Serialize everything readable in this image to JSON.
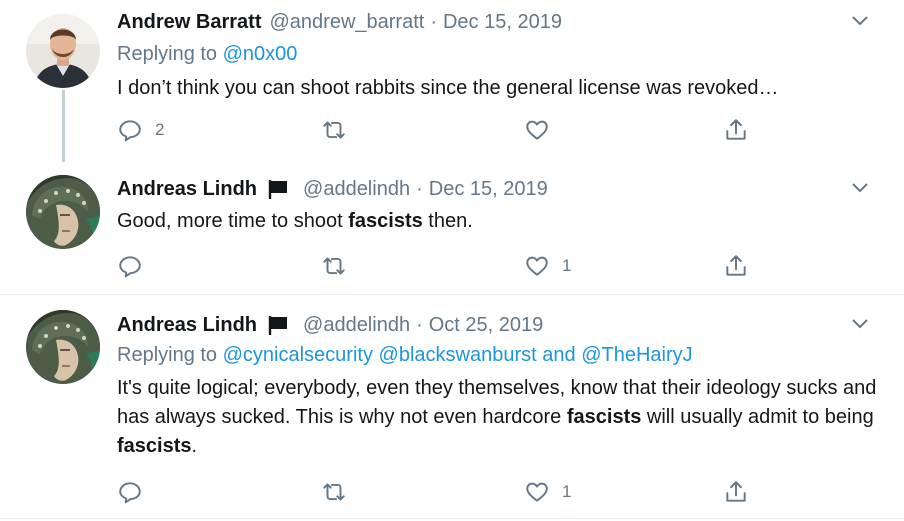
{
  "tweets": [
    {
      "author_name": "Andrew Barratt",
      "handle": "@andrew_barratt",
      "separator": "·",
      "date": "Dec 15, 2019",
      "replying_prefix": "Replying to",
      "replying_to": "@n0x00",
      "text": "I don’t think you can shoot rabbits since the general license was revoked…",
      "reply_count": "2",
      "retweet_count": "",
      "like_count": ""
    },
    {
      "author_name": "Andreas Lindh",
      "handle": "@addelindh",
      "separator": "·",
      "date": "Dec 15, 2019",
      "text_before": "Good, more time to shoot ",
      "text_bold": "fascists",
      "text_after": " then.",
      "reply_count": "",
      "retweet_count": "",
      "like_count": "1"
    },
    {
      "author_name": "Andreas Lindh",
      "handle": "@addelindh",
      "separator": "·",
      "date": "Oct 25, 2019",
      "replying_prefix": "Replying to",
      "replying_mention_1": "@cynicalsecurity",
      "replying_mention_2": "@blackswanburst",
      "replying_and": "and",
      "replying_mention_3": "@TheHairyJ",
      "text_part_1": "It's quite logical; everybody, even they themselves, know that their ideology sucks and has always sucked. This is why not even hardcore ",
      "text_bold_1": "fascists",
      "text_part_2": " will usually admit to being ",
      "text_bold_2": "fascists",
      "text_part_3": ".",
      "reply_count": "",
      "retweet_count": "",
      "like_count": "1"
    }
  ],
  "icons": {
    "reply": "reply-icon",
    "retweet": "retweet-icon",
    "like": "heart-icon",
    "share": "share-icon",
    "more": "chevron-down-icon",
    "flag": "flag-icon"
  },
  "colors": {
    "text": "#14171a",
    "secondary": "#657786",
    "link": "#1b95e0",
    "thread_line": "#c4cfd6",
    "divider": "#e6ecf0"
  }
}
